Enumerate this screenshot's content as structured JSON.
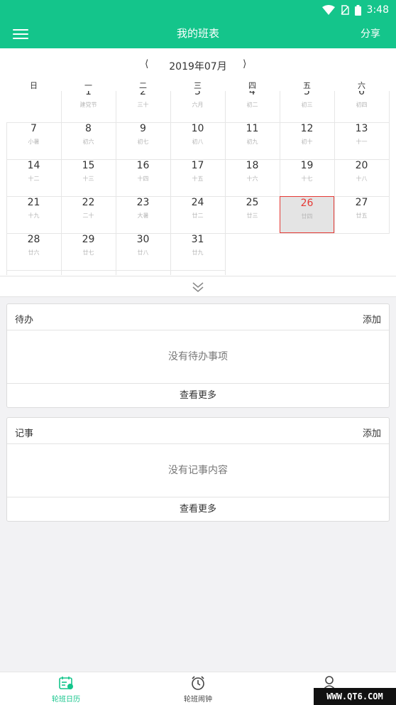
{
  "status": {
    "time": "3:48",
    "icons": [
      "wifi-icon",
      "no-sim-icon",
      "battery-icon"
    ]
  },
  "appbar": {
    "title": "我的班表",
    "share": "分享"
  },
  "calendar": {
    "month_label": "2019年07月",
    "prev": "⟨",
    "next": "⟩",
    "weekdays": [
      "日",
      "一",
      "二",
      "三",
      "四",
      "五",
      "六"
    ],
    "days": [
      {
        "n": "1",
        "l": "建党节",
        "col": 1,
        "row": 0
      },
      {
        "n": "2",
        "l": "三十",
        "col": 2,
        "row": 0
      },
      {
        "n": "3",
        "l": "六月",
        "col": 3,
        "row": 0
      },
      {
        "n": "4",
        "l": "初二",
        "col": 4,
        "row": 0
      },
      {
        "n": "5",
        "l": "初三",
        "col": 5,
        "row": 0
      },
      {
        "n": "6",
        "l": "初四",
        "col": 6,
        "row": 0
      },
      {
        "n": "7",
        "l": "小暑",
        "col": 0,
        "row": 1
      },
      {
        "n": "8",
        "l": "初六",
        "col": 1,
        "row": 1
      },
      {
        "n": "9",
        "l": "初七",
        "col": 2,
        "row": 1
      },
      {
        "n": "10",
        "l": "初八",
        "col": 3,
        "row": 1
      },
      {
        "n": "11",
        "l": "初九",
        "col": 4,
        "row": 1
      },
      {
        "n": "12",
        "l": "初十",
        "col": 5,
        "row": 1
      },
      {
        "n": "13",
        "l": "十一",
        "col": 6,
        "row": 1
      },
      {
        "n": "14",
        "l": "十二",
        "col": 0,
        "row": 2
      },
      {
        "n": "15",
        "l": "十三",
        "col": 1,
        "row": 2
      },
      {
        "n": "16",
        "l": "十四",
        "col": 2,
        "row": 2
      },
      {
        "n": "17",
        "l": "十五",
        "col": 3,
        "row": 2
      },
      {
        "n": "18",
        "l": "十六",
        "col": 4,
        "row": 2
      },
      {
        "n": "19",
        "l": "十七",
        "col": 5,
        "row": 2
      },
      {
        "n": "20",
        "l": "十八",
        "col": 6,
        "row": 2
      },
      {
        "n": "21",
        "l": "十九",
        "col": 0,
        "row": 3
      },
      {
        "n": "22",
        "l": "二十",
        "col": 1,
        "row": 3
      },
      {
        "n": "23",
        "l": "大暑",
        "col": 2,
        "row": 3
      },
      {
        "n": "24",
        "l": "廿二",
        "col": 3,
        "row": 3
      },
      {
        "n": "25",
        "l": "廿三",
        "col": 4,
        "row": 3
      },
      {
        "n": "26",
        "l": "廿四",
        "col": 5,
        "row": 3,
        "today": true
      },
      {
        "n": "27",
        "l": "廿五",
        "col": 6,
        "row": 3
      },
      {
        "n": "28",
        "l": "廿六",
        "col": 0,
        "row": 4
      },
      {
        "n": "29",
        "l": "廿七",
        "col": 1,
        "row": 4
      },
      {
        "n": "30",
        "l": "廿八",
        "col": 2,
        "row": 4
      },
      {
        "n": "31",
        "l": "廿九",
        "col": 3,
        "row": 4
      }
    ]
  },
  "todo": {
    "title": "待办",
    "add": "添加",
    "empty": "没有待办事项",
    "more": "查看更多"
  },
  "notes": {
    "title": "记事",
    "add": "添加",
    "empty": "没有记事内容",
    "more": "查看更多"
  },
  "tabs": [
    {
      "label": "轮班日历",
      "icon": "calendar-icon",
      "active": true
    },
    {
      "label": "轮班闹钟",
      "icon": "alarm-clock-icon",
      "active": false
    },
    {
      "label": "",
      "icon": "profile-icon",
      "active": false
    }
  ],
  "watermark": "WWW.QT6.COM",
  "colors": {
    "accent": "#14c58b",
    "today_border": "#e53935"
  }
}
